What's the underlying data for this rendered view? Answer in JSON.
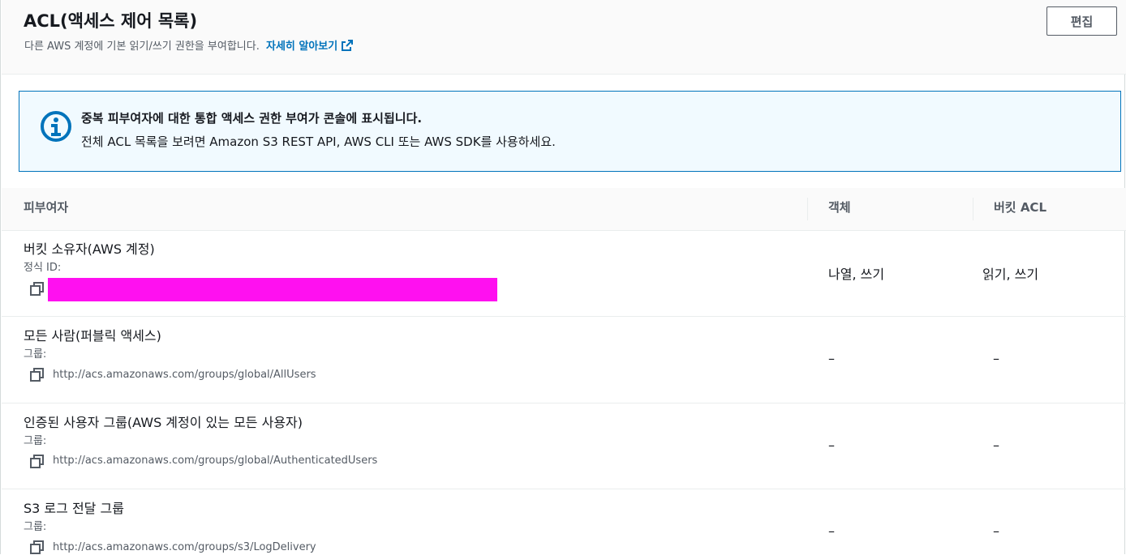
{
  "header": {
    "title": "ACL(액세스 제어 목록)",
    "description": "다른 AWS 계정에 기본 읽기/쓰기 권한을 부여합니다.",
    "learn_more": "자세히 알아보기",
    "edit_button": "편집"
  },
  "alert": {
    "title": "중복 피부여자에 대한 통합 액세스 권한 부여가 콘솔에 표시됩니다.",
    "body": "전체 ACL 목록을 보려면 Amazon S3 REST API, AWS CLI 또는 AWS SDK를 사용하세요."
  },
  "table": {
    "columns": [
      "피부여자",
      "객체",
      "버킷 ACL"
    ],
    "rows": [
      {
        "name": "버킷 소유자(AWS 계정)",
        "sub_label": "정식 ID:",
        "identifier": "",
        "objects": "나열, 쓰기",
        "bucket_acl": "읽기, 쓰기"
      },
      {
        "name": "모든 사람(퍼블릭 액세스)",
        "sub_label": "그룹:",
        "identifier": "http://acs.amazonaws.com/groups/global/AllUsers",
        "objects": "–",
        "bucket_acl": "–"
      },
      {
        "name": "인증된 사용자 그룹(AWS 계정이 있는 모든 사용자)",
        "sub_label": "그룹:",
        "identifier": "http://acs.amazonaws.com/groups/global/AuthenticatedUsers",
        "objects": "–",
        "bucket_acl": "–"
      },
      {
        "name": "S3 로그 전달 그룹",
        "sub_label": "그룹:",
        "identifier": "http://acs.amazonaws.com/groups/s3/LogDelivery",
        "objects": "–",
        "bucket_acl": "–"
      }
    ]
  },
  "icons": {
    "info": "info-icon",
    "external_link": "external-link-icon",
    "copy": "copy-icon"
  },
  "colors": {
    "link": "#0073bb",
    "alert_border": "#0073bb",
    "alert_bg": "#f1faff",
    "info_icon": "#0073bb",
    "redaction": "#ff10f0"
  }
}
